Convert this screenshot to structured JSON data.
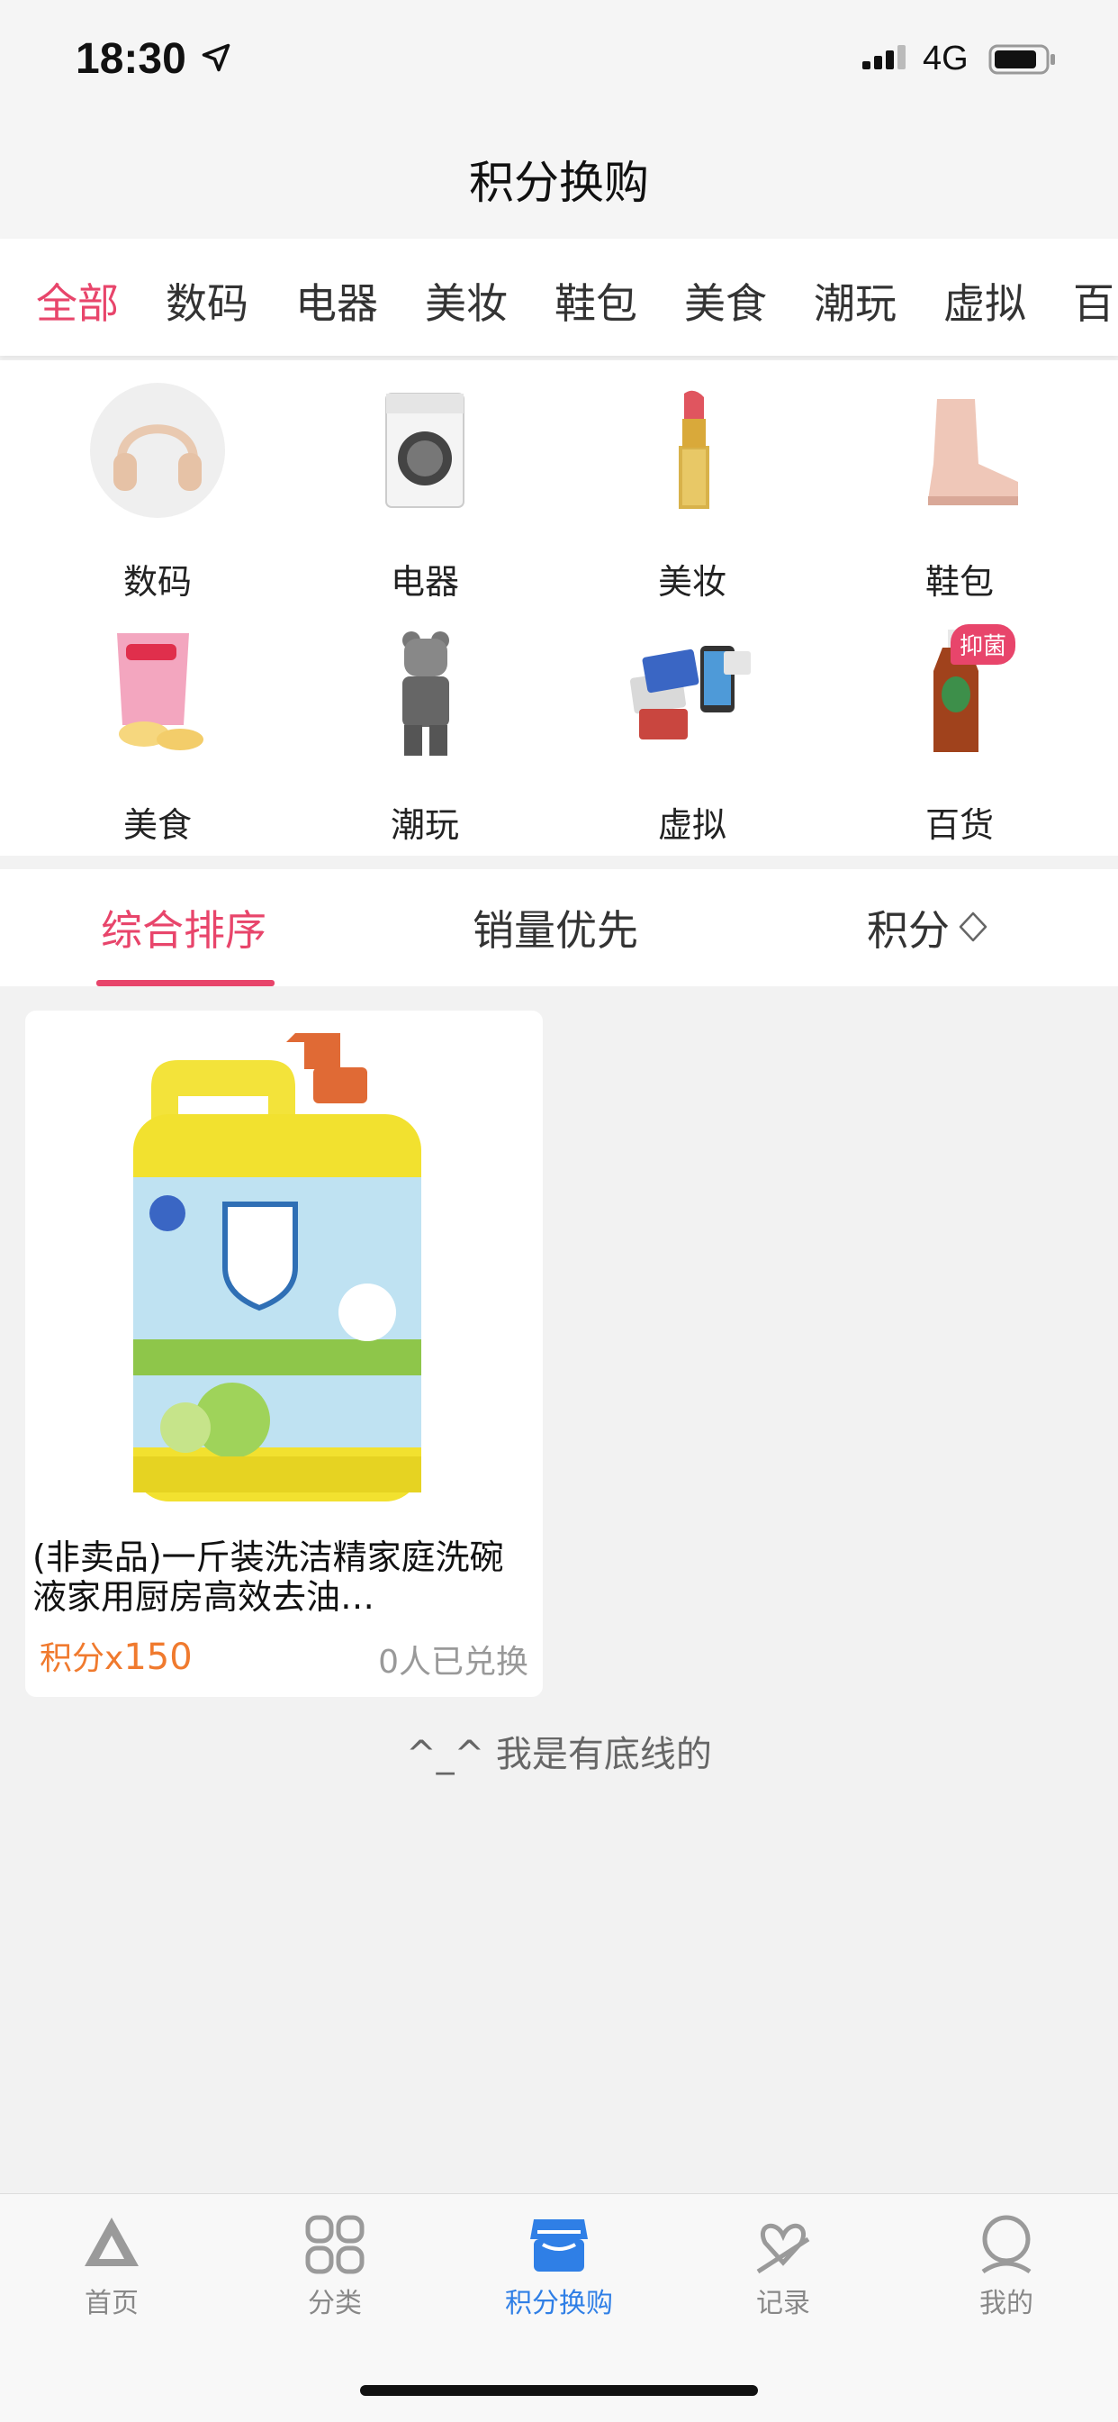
{
  "status": {
    "time": "18:30",
    "network": "4G"
  },
  "header": {
    "title": "积分换购"
  },
  "category_tabs": [
    {
      "label": "全部",
      "active": true
    },
    {
      "label": "数码"
    },
    {
      "label": "电器"
    },
    {
      "label": "美妆"
    },
    {
      "label": "鞋包"
    },
    {
      "label": "美食"
    },
    {
      "label": "潮玩"
    },
    {
      "label": "虚拟"
    },
    {
      "label": "百"
    }
  ],
  "category_grid": [
    {
      "label": "数码",
      "icon": "headphones-icon"
    },
    {
      "label": "电器",
      "icon": "washing-machine-icon"
    },
    {
      "label": "美妆",
      "icon": "lipstick-icon"
    },
    {
      "label": "鞋包",
      "icon": "boot-icon"
    },
    {
      "label": "美食",
      "icon": "chips-icon"
    },
    {
      "label": "潮玩",
      "icon": "bear-figure-icon"
    },
    {
      "label": "虚拟",
      "icon": "cards-phone-icon"
    },
    {
      "label": "百货",
      "icon": "disinfectant-icon",
      "badge": "抑菌"
    }
  ],
  "sort_tabs": [
    {
      "label": "综合排序",
      "active": true
    },
    {
      "label": "销量优先"
    },
    {
      "label": "积分"
    }
  ],
  "products": [
    {
      "title": "(非卖品)一斤装洗洁精家庭洗碗液家用厨房高效去油…",
      "points_label": "积分x",
      "points": "150",
      "exchanged": "0人已兑换",
      "image": "dish-soap-bottle"
    }
  ],
  "footer_note": "^_^ 我是有底线的",
  "tabbar": [
    {
      "label": "首页",
      "icon": "home-icon"
    },
    {
      "label": "分类",
      "icon": "category-grid-icon"
    },
    {
      "label": "积分换购",
      "icon": "points-shop-icon",
      "active": true
    },
    {
      "label": "记录",
      "icon": "record-icon"
    },
    {
      "label": "我的",
      "icon": "profile-icon"
    }
  ],
  "colors": {
    "accent": "#e8456b",
    "points": "#f07a2e",
    "tab_active": "#2f7fe6"
  }
}
